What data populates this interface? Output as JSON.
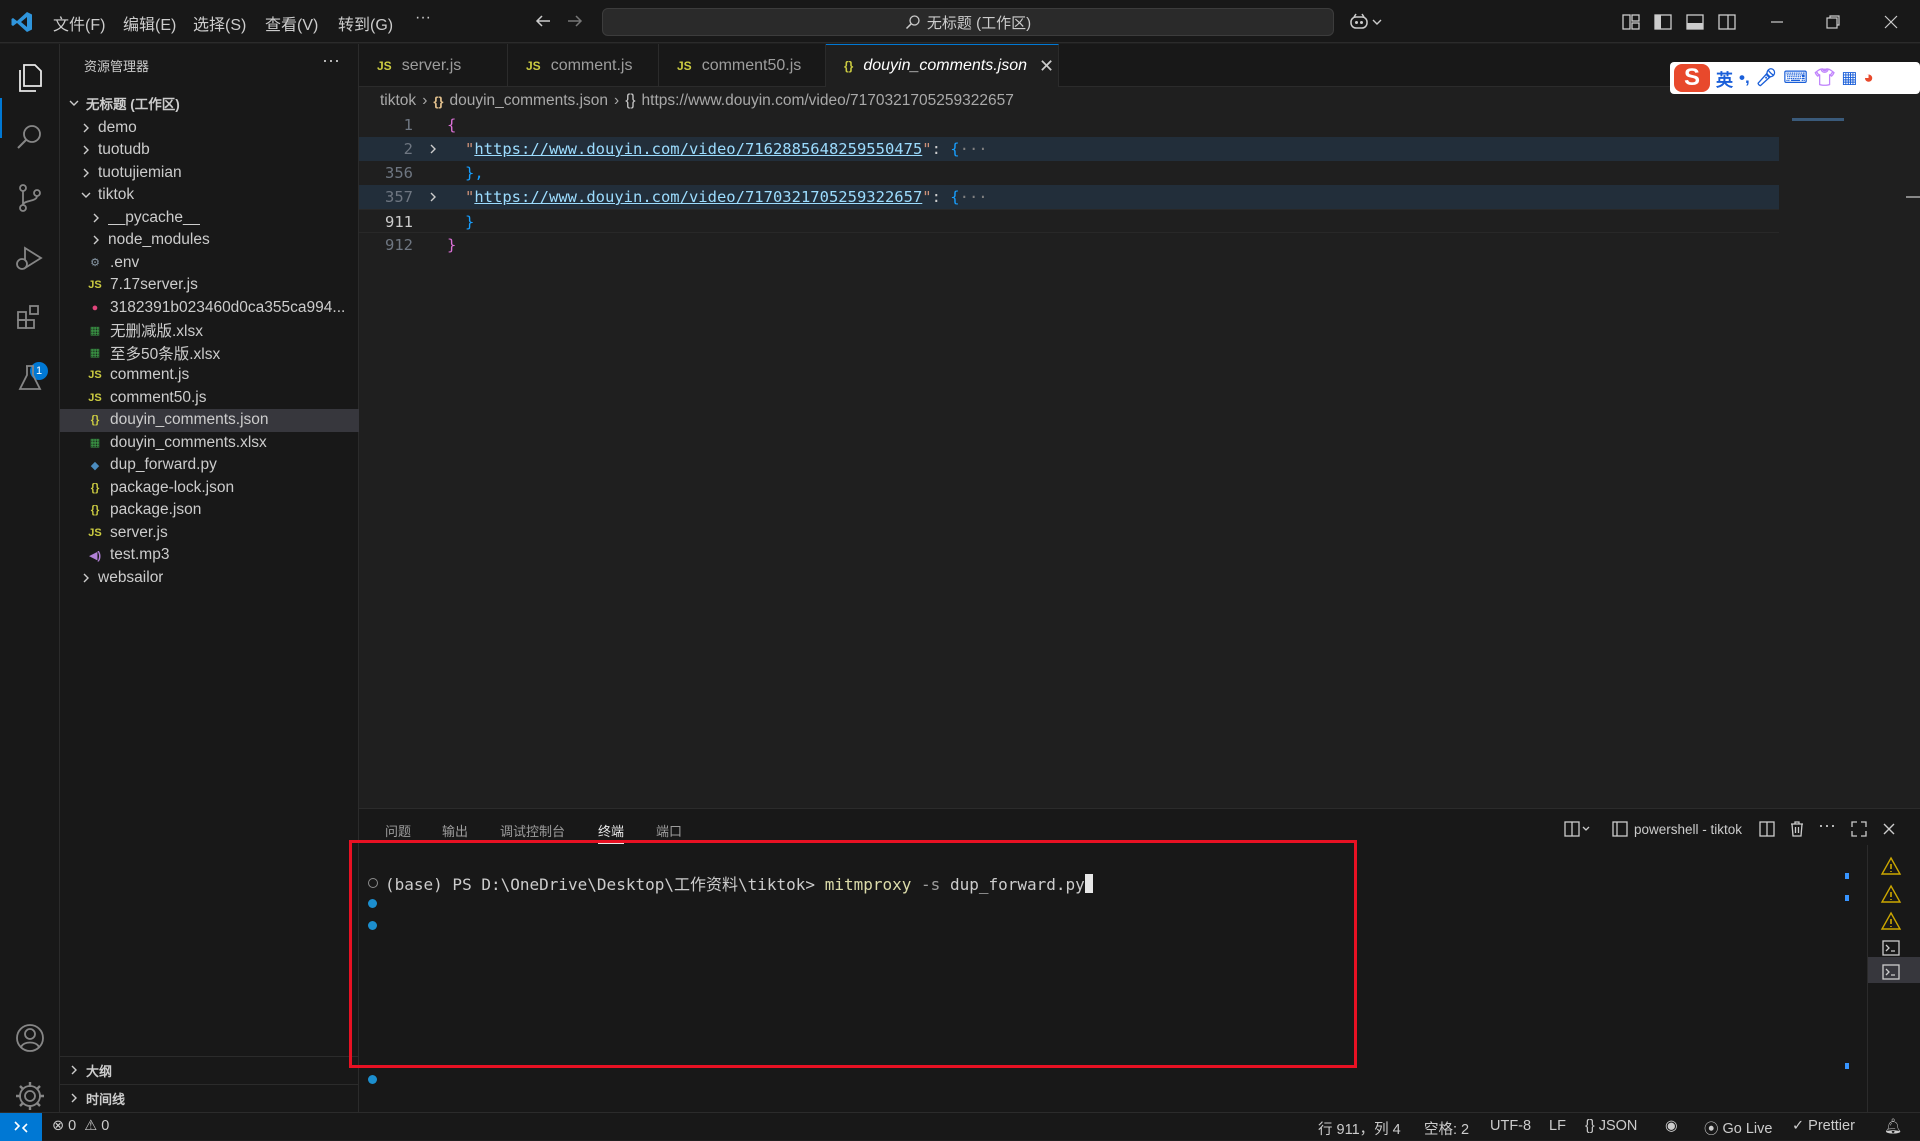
{
  "titlebar": {
    "menus": [
      "文件(F)",
      "编辑(E)",
      "选择(S)",
      "查看(V)",
      "转到(G)"
    ],
    "more": "···",
    "search_text": "无标题 (工作区)"
  },
  "activity": {
    "extensions_badge": "1"
  },
  "sidebar": {
    "title": "资源管理器",
    "more": "···",
    "workspace": "无标题 (工作区)",
    "items": [
      {
        "label": "demo",
        "kind": "folder",
        "depth": 1,
        "icon": "chevron-right"
      },
      {
        "label": "tuotudb",
        "kind": "folder",
        "depth": 1,
        "icon": "chevron-right"
      },
      {
        "label": "tuotujiemian",
        "kind": "folder",
        "depth": 1,
        "icon": "chevron-right"
      },
      {
        "label": "tiktok",
        "kind": "folder-open",
        "depth": 1,
        "icon": "chevron-down"
      },
      {
        "label": "__pycache__",
        "kind": "folder",
        "depth": 2,
        "icon": "chevron-right"
      },
      {
        "label": "node_modules",
        "kind": "folder",
        "depth": 2,
        "icon": "chevron-right"
      },
      {
        "label": ".env",
        "kind": "env",
        "depth": 2,
        "icon": "gear"
      },
      {
        "label": "7.17server.js",
        "kind": "js",
        "depth": 2,
        "icon": "JS"
      },
      {
        "label": "3182391b023460d0ca355ca994...",
        "kind": "media",
        "depth": 2,
        "icon": "play"
      },
      {
        "label": "无删减版.xlsx",
        "kind": "xlsx",
        "depth": 2,
        "icon": "xlsx"
      },
      {
        "label": "至多50条版.xlsx",
        "kind": "xlsx",
        "depth": 2,
        "icon": "xlsx"
      },
      {
        "label": "comment.js",
        "kind": "js",
        "depth": 2,
        "icon": "JS"
      },
      {
        "label": "comment50.js",
        "kind": "js",
        "depth": 2,
        "icon": "JS"
      },
      {
        "label": "douyin_comments.json",
        "kind": "json",
        "depth": 2,
        "icon": "{}",
        "selected": true
      },
      {
        "label": "douyin_comments.xlsx",
        "kind": "xlsx",
        "depth": 2,
        "icon": "xlsx"
      },
      {
        "label": "dup_forward.py",
        "kind": "py",
        "depth": 2,
        "icon": "python"
      },
      {
        "label": "package-lock.json",
        "kind": "json",
        "depth": 2,
        "icon": "{}"
      },
      {
        "label": "package.json",
        "kind": "json",
        "depth": 2,
        "icon": "{}"
      },
      {
        "label": "server.js",
        "kind": "js",
        "depth": 2,
        "icon": "JS"
      },
      {
        "label": "test.mp3",
        "kind": "audio",
        "depth": 2,
        "icon": "speaker"
      },
      {
        "label": "websailor",
        "kind": "folder",
        "depth": 1,
        "icon": "chevron-right"
      }
    ],
    "outline": "大纲",
    "timeline": "时间线"
  },
  "tabs": [
    {
      "label": "server.js",
      "icon": "JS",
      "active": false
    },
    {
      "label": "comment.js",
      "icon": "JS",
      "active": false
    },
    {
      "label": "comment50.js",
      "icon": "JS",
      "active": false
    },
    {
      "label": "douyin_comments.json",
      "icon": "{}",
      "active": true
    }
  ],
  "ime": {
    "lang": "英"
  },
  "breadcrumb": [
    "tiktok",
    "douyin_comments.json",
    "https://www.douyin.com/video/7170321705259322657"
  ],
  "editor": {
    "lines": [
      {
        "num": "1",
        "text": "{",
        "fold": false
      },
      {
        "num": "2",
        "key": "https://www.douyin.com/video/7162885648259550475",
        "fold": true
      },
      {
        "num": "356",
        "text": "},",
        "fold": false
      },
      {
        "num": "357",
        "key": "https://www.douyin.com/video/7170321705259322657",
        "fold": true
      },
      {
        "num": "911",
        "text": "}",
        "fold": false,
        "current": true
      },
      {
        "num": "912",
        "text": "}",
        "fold": false
      }
    ],
    "ellipsis": "···"
  },
  "panel": {
    "tabs": [
      "问题",
      "输出",
      "调试控制台",
      "终端",
      "端口"
    ],
    "active_tab": "终端",
    "terminal_name": "powershell - tiktok",
    "prompt": "(base) PS D:\\OneDrive\\Desktop\\工作资料\\tiktok> ",
    "command": "mitmproxy",
    "flag": "-s",
    "arg": "dup_forward.py"
  },
  "statusbar": {
    "errors": "0",
    "warnings": "0",
    "position": "行 911，列 4",
    "spaces": "空格: 2",
    "encoding": "UTF-8",
    "eol": "LF",
    "language": "JSON",
    "golive": "Go Live",
    "prettier": "Prettier"
  },
  "colors": {
    "accent": "#0078d4",
    "highlight_box": "#e81123",
    "json_string": "#ce9178",
    "json_key_link": "#9cdcfe"
  }
}
